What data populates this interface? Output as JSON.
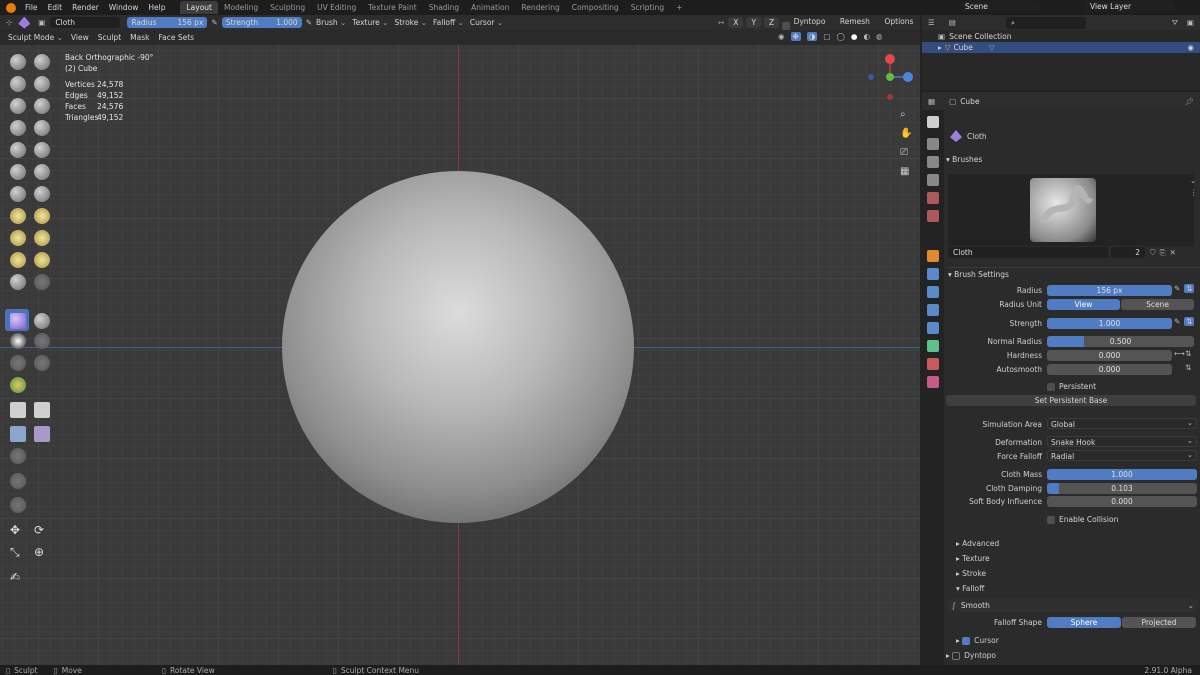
{
  "menu": [
    "File",
    "Edit",
    "Render",
    "Window",
    "Help"
  ],
  "workspaces": [
    "Layout",
    "Modeling",
    "Sculpting",
    "UV Editing",
    "Texture Paint",
    "Shading",
    "Animation",
    "Rendering",
    "Compositing",
    "Scripting"
  ],
  "active_workspace": "Layout",
  "scene": "Scene",
  "view_layer": "View Layer",
  "tool_header": {
    "brush_name": "Cloth",
    "radius_label": "Radius",
    "radius_value": "156 px",
    "strength_label": "Strength",
    "strength_value": "1.000",
    "menus": [
      "Brush",
      "Texture",
      "Stroke",
      "Falloff",
      "Cursor"
    ],
    "axes": [
      "X",
      "Y",
      "Z"
    ],
    "right": [
      "Dyntopo",
      "Remesh",
      "Options"
    ]
  },
  "viewport_header": {
    "mode": "Sculpt Mode",
    "menus": [
      "View",
      "Sculpt",
      "Mask",
      "Face Sets"
    ]
  },
  "overlay": {
    "view_name": "Back Orthographic -90°",
    "object": "(2) Cube",
    "stats": [
      {
        "label": "Vertices",
        "value": "24,578"
      },
      {
        "label": "Edges",
        "value": "49,152"
      },
      {
        "label": "Faces",
        "value": "24,576"
      },
      {
        "label": "Triangles",
        "value": "49,152"
      }
    ]
  },
  "outliner": {
    "collection": "Scene Collection",
    "item": "Cube"
  },
  "properties": {
    "object": "Cube",
    "brush_name": "Cloth",
    "brushes_panel": "Brushes",
    "brush_field": "Cloth",
    "brush_users": "2",
    "brush_settings": "Brush Settings",
    "radius_label": "Radius",
    "radius_value": "156 px",
    "radius_unit_label": "Radius Unit",
    "unit_view": "View",
    "unit_scene": "Scene",
    "strength_label": "Strength",
    "strength_value": "1.000",
    "normal_radius_label": "Normal Radius",
    "normal_radius_value": "0.500",
    "hardness_label": "Hardness",
    "hardness_value": "0.000",
    "autosmooth_label": "Autosmooth",
    "autosmooth_value": "0.000",
    "persistent_label": "Persistent",
    "set_persistent_base": "Set Persistent Base",
    "simulation_area_label": "Simulation Area",
    "simulation_area_value": "Global",
    "deformation_label": "Deformation",
    "deformation_value": "Snake Hook",
    "force_falloff_label": "Force Falloff",
    "force_falloff_value": "Radial",
    "cloth_mass_label": "Cloth Mass",
    "cloth_mass_value": "1.000",
    "cloth_damping_label": "Cloth Damping",
    "cloth_damping_value": "0.103",
    "soft_body_label": "Soft Body Influence",
    "soft_body_value": "0.000",
    "enable_collision_label": "Enable Collision",
    "sections": [
      "Advanced",
      "Texture",
      "Stroke",
      "Falloff"
    ],
    "falloff_curve": "Smooth",
    "falloff_shape_label": "Falloff Shape",
    "shape_sphere": "Sphere",
    "shape_projected": "Projected",
    "cursor_label": "Cursor",
    "dyntopo_label": "Dyntopo"
  },
  "statusbar": {
    "left": "Sculpt",
    "move": "Move",
    "rotate": "Rotate View",
    "context": "Sculpt Context Menu",
    "version": "2.91.0 Alpha"
  },
  "colors": {
    "accent": "#4f7cc3",
    "viewport_bg": "#3a3a3a",
    "x_axis": "#c23b3b",
    "z_axis": "#4a78c8"
  }
}
